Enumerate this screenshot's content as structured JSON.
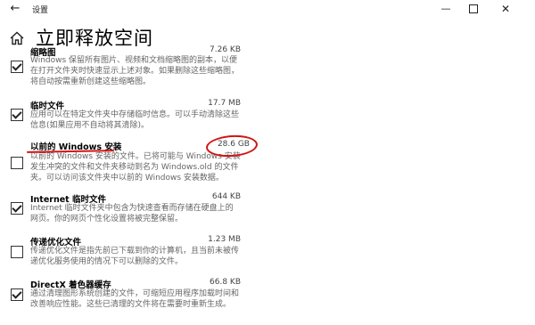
{
  "window": {
    "title": "设置",
    "back_glyph": "←",
    "minimize_glyph": "—",
    "close_glyph": "✕"
  },
  "page": {
    "title": "立即释放空间"
  },
  "rows": [
    {
      "label": "缩略图",
      "size": "7.26 KB",
      "checked": true,
      "desc": "Windows 保留所有图片、视频和文档缩略图的副本，以便在打开文件夹时快速显示上述对象。如果删除这些缩略图，将自动按需重新创建这些缩略图。"
    },
    {
      "label": "临时文件",
      "size": "17.7 MB",
      "checked": true,
      "desc": "应用可以在特定文件夹中存储临时信息。可以手动清除这些信息(如果应用不自动将其清除)。"
    },
    {
      "label": "以前的 Windows 安装",
      "size": "28.6 GB",
      "checked": false,
      "desc": "以前的 Windows 安装的文件。已将可能与 Windows 安装发生冲突的文件和文件夹移动到名为 Windows.old 的文件夹。可以访问该文件夹中以前的 Windows 安装数据。"
    },
    {
      "label": "Internet 临时文件",
      "size": "644 KB",
      "checked": true,
      "desc": "Internet 临时文件夹中包含为快速查看而存储在硬盘上的网页。你的网页个性化设置将被完整保留。"
    },
    {
      "label": "传递优化文件",
      "size": "1.23 MB",
      "checked": false,
      "desc": "传递优化文件是指先前已下载到你的计算机，且当前未被传递优化服务使用的情况下可以删除的文件。"
    },
    {
      "label": "DirectX 着色器缓存",
      "size": "66.8 KB",
      "checked": true,
      "desc": "通过清理图形系统创建的文件，可缩短应用程序加载时间和改善响应性能。这些已清理的文件将在需要时重新生成。"
    }
  ],
  "colors": {
    "annotation": "#d31414"
  },
  "icons": {
    "home": "home-icon",
    "back": "back-arrow-icon",
    "check": "checkmark-icon"
  }
}
